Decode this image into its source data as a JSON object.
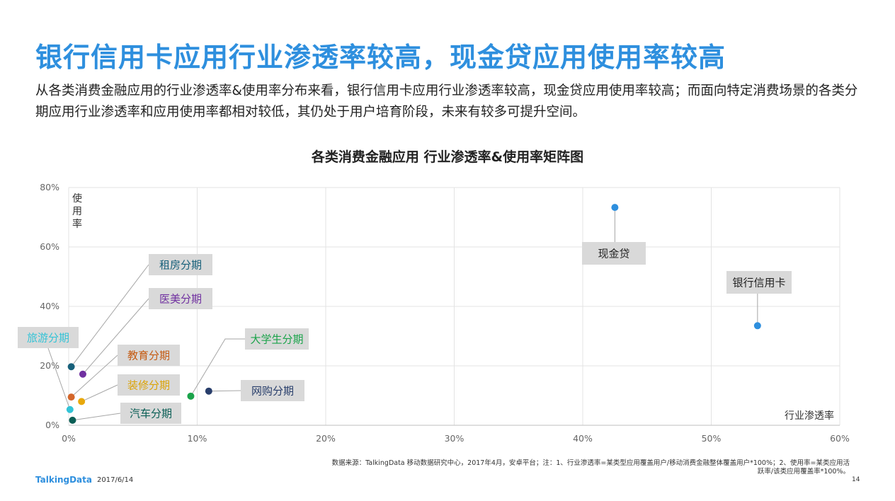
{
  "slide": {
    "title": "银行信用卡应用行业渗透率较高，现金贷应用使用率较高",
    "subtitle": "从各类消费金融应用的行业渗透率&使用率分布来看，银行信用卡应用行业渗透率较高，现金贷应用使用率较高；而面向特定消费场景的各类分期应用行业渗透率和应用使用率都相对较低，其仍处于用户培育阶段，未来有较多可提升空间。",
    "source": "数据来源：TalkingData 移动数据研究中心，2017年4月，安卓平台；注：1、行业渗透率=某类型应用覆盖用户/移动消费金融整体覆盖用户*100%；2、使用率=某类应用活跃率/该类应用覆盖率*100%。",
    "brand": "TalkingData",
    "date": "2017/6/14",
    "page_number": "14"
  },
  "chart_data": {
    "type": "scatter",
    "title": "各类消费金融应用 行业渗透率&使用率矩阵图",
    "xlabel": "行业渗透率",
    "ylabel": "使用率",
    "xlim": [
      0,
      60
    ],
    "ylim": [
      0,
      80
    ],
    "x_ticks": [
      "0%",
      "10%",
      "20%",
      "30%",
      "40%",
      "50%",
      "60%"
    ],
    "y_ticks": [
      "0%",
      "20%",
      "40%",
      "60%",
      "80%"
    ],
    "grid": true,
    "points": [
      {
        "name": "租房分期",
        "x": 0.2,
        "y": 19.7,
        "color": "#17607a",
        "label_color": "#17607a"
      },
      {
        "name": "医美分期",
        "x": 1.1,
        "y": 17.2,
        "color": "#7030a0",
        "label_color": "#7030a0"
      },
      {
        "name": "旅游分期",
        "x": 0.1,
        "y": 5.3,
        "color": "#33c3d6",
        "label_color": "#33c3d6"
      },
      {
        "name": "教育分期",
        "x": 0.2,
        "y": 9.5,
        "color": "#d4662a",
        "label_color": "#c55a11"
      },
      {
        "name": "装修分期",
        "x": 1.0,
        "y": 8.0,
        "color": "#e8a80c",
        "label_color": "#dba308"
      },
      {
        "name": "汽车分期",
        "x": 0.3,
        "y": 1.7,
        "color": "#0a5e55",
        "label_color": "#0a5e55"
      },
      {
        "name": "大学生分期",
        "x": 9.5,
        "y": 9.8,
        "color": "#1aa34a",
        "label_color": "#1aa34a"
      },
      {
        "name": "网购分期",
        "x": 10.9,
        "y": 11.5,
        "color": "#283e6b",
        "label_color": "#283e6b"
      },
      {
        "name": "现金贷",
        "x": 42.5,
        "y": 73.3,
        "color": "#2e8fde",
        "label_color": "#222222"
      },
      {
        "name": "银行信用卡",
        "x": 53.6,
        "y": 33.5,
        "color": "#2e8fde",
        "label_color": "#222222"
      }
    ]
  }
}
